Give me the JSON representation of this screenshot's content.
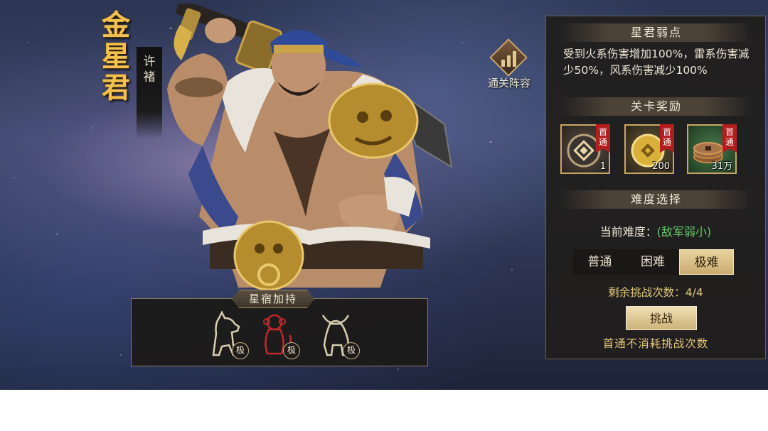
{
  "hero": {
    "title_chars": [
      "金",
      "星",
      "君"
    ],
    "name_chars": [
      "许",
      "褚"
    ]
  },
  "lineup": {
    "label": "通关阵容",
    "icon": "bar-chart-icon"
  },
  "weakness": {
    "header": "星君弱点",
    "text": "受到火系伤害增加100%，雷系伤害减少50%，风系伤害减少100%"
  },
  "rewards": {
    "header": "关卡奖励",
    "items": [
      {
        "badge": "首通",
        "count": "1",
        "icon": "jade-token-icon"
      },
      {
        "badge": "首通",
        "count": "200",
        "icon": "gold-coin-icon"
      },
      {
        "badge": "首通",
        "count": "31万",
        "icon": "copper-coins-icon"
      }
    ]
  },
  "difficulty": {
    "header": "难度选择",
    "current_label": "当前难度：",
    "current_value": "(敌军弱小)",
    "options": [
      "普通",
      "困难",
      "极难"
    ],
    "selected": "极难",
    "remaining": "剩余挑战次数：4/4",
    "challenge_button": "挑战",
    "note": "首通不消耗挑战次数"
  },
  "star_bonus": {
    "header": "星宿加持",
    "items": [
      {
        "icon": "dog-icon",
        "tag": "极",
        "color": "#d9cfae"
      },
      {
        "icon": "monkey-icon",
        "tag": "极",
        "color": "#c0282c"
      },
      {
        "icon": "ox-icon",
        "tag": "极",
        "color": "#d9cfae"
      }
    ]
  }
}
